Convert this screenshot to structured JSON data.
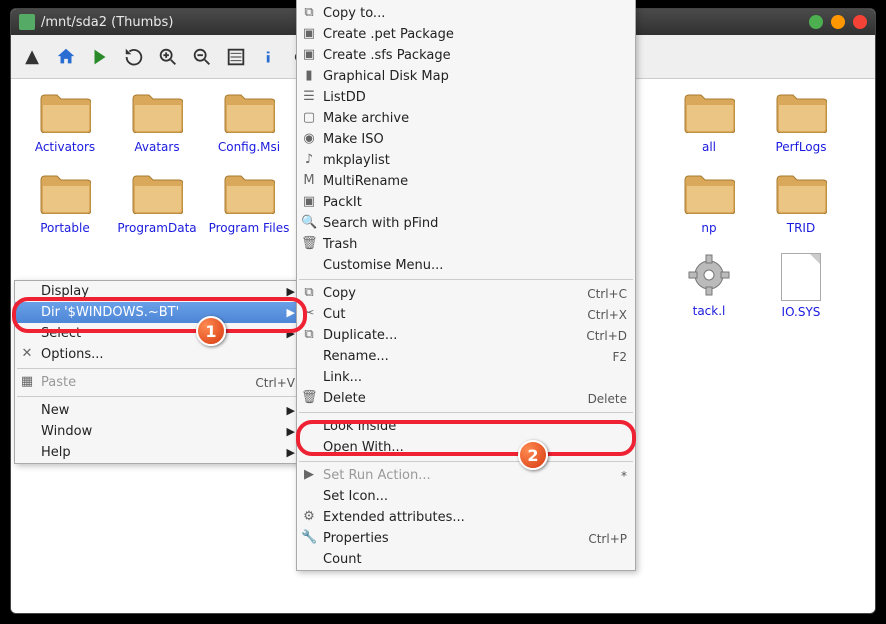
{
  "window": {
    "title": "/mnt/sda2 (Thumbs)"
  },
  "folders_row1": [
    {
      "label": "Activators"
    },
    {
      "label": "Avatars"
    },
    {
      "label": "Config.Msi"
    },
    {
      "label": ""
    },
    {
      "label": ""
    },
    {
      "label": ""
    },
    {
      "label": ""
    },
    {
      "label": "all"
    },
    {
      "label": "PerfLogs"
    }
  ],
  "folders_row2": [
    {
      "label": "Portable"
    },
    {
      "label": "ProgramData"
    },
    {
      "label": "Program Files"
    },
    {
      "label": ""
    },
    {
      "label": ""
    },
    {
      "label": ""
    },
    {
      "label": ""
    },
    {
      "label": "np"
    },
    {
      "label": "TRID"
    }
  ],
  "files_row3": {
    "gear": "tack.l",
    "file": "IO.SYS"
  },
  "menu1": {
    "display": "Display",
    "dir": "Dir '$WINDOWS.~BT'",
    "select": "Select",
    "options": "Options...",
    "paste": "Paste",
    "paste_sc": "Ctrl+V",
    "new": "New",
    "window": "Window",
    "help": "Help"
  },
  "menu2": {
    "copyto": "Copy to...",
    "pet": "Create .pet Package",
    "sfs": "Create .sfs Package",
    "gdm": "Graphical Disk Map",
    "listdd": "ListDD",
    "makearch": "Make archive",
    "makeiso": "Make ISO",
    "mkplay": "mkplaylist",
    "multiren": "MultiRename",
    "packit": "PackIt",
    "pfind": "Search with pFind",
    "trash": "Trash",
    "custmenu": "Customise Menu...",
    "copy": "Copy",
    "copy_sc": "Ctrl+C",
    "cut": "Cut",
    "cut_sc": "Ctrl+X",
    "dup": "Duplicate...",
    "dup_sc": "Ctrl+D",
    "rename": "Rename...",
    "rename_sc": "F2",
    "link": "Link...",
    "delete": "Delete",
    "delete_sc": "Delete",
    "look": "Look Inside",
    "openwith": "Open With...",
    "setrun": "Set Run Action...",
    "setrun_sc": "*",
    "seticon": "Set Icon...",
    "extattr": "Extended attributes...",
    "props": "Properties",
    "props_sc": "Ctrl+P",
    "count": "Count"
  },
  "badges": {
    "b1": "1",
    "b2": "2"
  }
}
